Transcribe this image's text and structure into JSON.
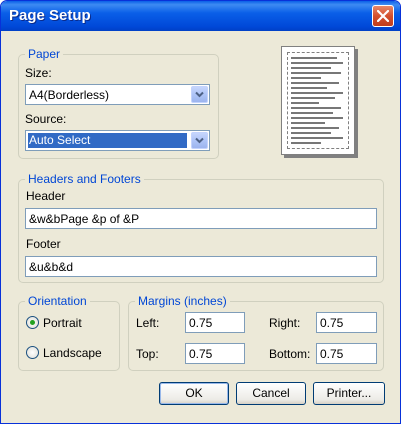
{
  "window": {
    "title": "Page Setup"
  },
  "paper": {
    "group_title": "Paper",
    "size_label": "Size:",
    "size_value": "A4(Borderless)",
    "source_label": "Source:",
    "source_value": "Auto Select"
  },
  "headers_footers": {
    "group_title": "Headers and Footers",
    "header_label": "Header",
    "header_value": "&w&bPage &p of &P",
    "footer_label": "Footer",
    "footer_value": "&u&b&d"
  },
  "orientation": {
    "group_title": "Orientation",
    "portrait_label": "Portrait",
    "landscape_label": "Landscape",
    "selected": "Portrait"
  },
  "margins": {
    "group_title": "Margins (inches)",
    "left_label": "Left:",
    "left_value": "0.75",
    "right_label": "Right:",
    "right_value": "0.75",
    "top_label": "Top:",
    "top_value": "0.75",
    "bottom_label": "Bottom:",
    "bottom_value": "0.75"
  },
  "buttons": {
    "ok": "OK",
    "cancel": "Cancel",
    "printer": "Printer..."
  },
  "colors": {
    "titlebar": "#0a5fe8",
    "group_title": "#0046d5",
    "selection": "#316ac5",
    "close_button": "#d4502e"
  }
}
